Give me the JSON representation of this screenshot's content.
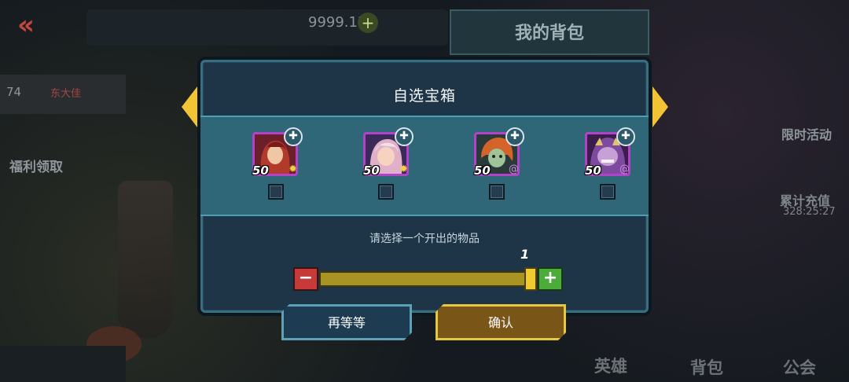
{
  "background": {
    "currency_value": "9999.1K",
    "title": "我的背包",
    "player_level": "74",
    "player_name": "东大佳",
    "welfare_label": "福利领取",
    "limited_event_label": "限时活动",
    "recharge_label": "累计充值",
    "timer": "328:25:27",
    "tabs": [
      "英雄",
      "背包",
      "公会"
    ]
  },
  "dialog": {
    "title": "自选宝箱",
    "hint": "请选择一个开出的物品",
    "quantity": "1",
    "quantity_fill": 1.0,
    "items": [
      {
        "level": "50",
        "element_icon": "sun-icon",
        "element_glyph": "✹",
        "element_color": "#f0d23a",
        "checked": false
      },
      {
        "level": "50",
        "element_icon": "sun-icon",
        "element_glyph": "✹",
        "element_color": "#f0d23a",
        "checked": false
      },
      {
        "level": "50",
        "element_icon": "spiral-icon",
        "element_glyph": "@",
        "element_color": "#c58be0",
        "checked": false
      },
      {
        "level": "50",
        "element_icon": "spiral-icon",
        "element_glyph": "@",
        "element_color": "#c58be0",
        "checked": false
      }
    ],
    "minus_label": "−",
    "plus_label": "+",
    "wait_button": "再等等",
    "confirm_button": "确认"
  },
  "colors": {
    "dialog_bg": "#1d3547",
    "strip_bg": "#2f6778",
    "hero_frame": "#b243c9",
    "confirm_border": "#e6c744"
  }
}
